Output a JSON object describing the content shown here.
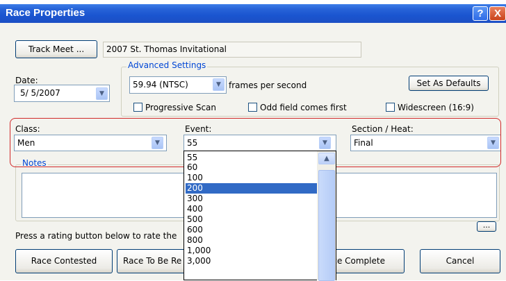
{
  "window": {
    "title": "Race Properties",
    "help_glyph": "?",
    "close_glyph": "X"
  },
  "track_meet": {
    "button_label": "Track Meet ...",
    "value": "2007 St. Thomas Invitational"
  },
  "date": {
    "label": "Date:",
    "value": "5/ 5/2007"
  },
  "advanced": {
    "group_title": "Advanced Settings",
    "fps_value": "59.94 (NTSC)",
    "fps_label": "frames per second",
    "defaults_button": "Set As Defaults",
    "progressive_scan": "Progressive Scan",
    "odd_field_first": "Odd field comes first",
    "widescreen": "Widescreen (16:9)"
  },
  "class": {
    "label": "Class:",
    "value": "Men"
  },
  "event": {
    "label": "Event:",
    "value": "55"
  },
  "section": {
    "label": "Section / Heat:",
    "value": "Final"
  },
  "notes": {
    "group_title": "Notes",
    "ellipsis_button": "..."
  },
  "rating_prompt": "Press a rating button below to rate the",
  "buttons": {
    "race_contested": "Race Contested",
    "race_to_be_reviewed": "Race To Be Re",
    "race_complete": "ace Complete",
    "cancel": "Cancel"
  },
  "event_dropdown": {
    "items": [
      "55",
      "60",
      "100",
      "200",
      "300",
      "400",
      "500",
      "600",
      "800",
      "1,000",
      "3,000"
    ],
    "selected": "200"
  },
  "accent_color": "#316ac5",
  "highlight_outline_color": "#d02828"
}
